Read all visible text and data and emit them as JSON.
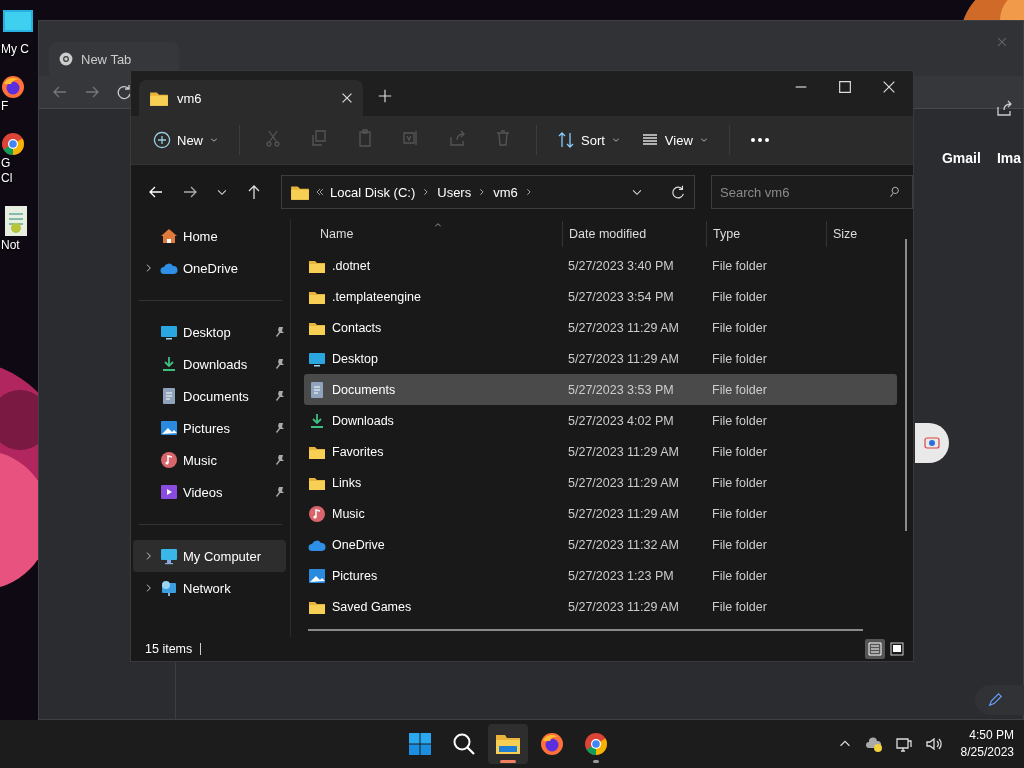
{
  "desktop_icons": [
    {
      "kind": "computer",
      "lines": [
        "My C"
      ]
    },
    {
      "kind": "firefox",
      "lines": [
        "F"
      ]
    },
    {
      "kind": "chrome",
      "lines": [
        "G",
        "Cl"
      ]
    },
    {
      "kind": "notepad",
      "lines": [
        "Not"
      ]
    }
  ],
  "browser": {
    "tab": "New Tab",
    "links": [
      "Gmail",
      "Ima"
    ]
  },
  "explorer": {
    "tab": {
      "title": "vm6"
    },
    "toolbar": {
      "new": "New",
      "sort": "Sort",
      "view": "View"
    },
    "address": {
      "crumbs": [
        "Local Disk (C:)",
        "Users",
        "vm6"
      ],
      "search_placeholder": "Search vm6"
    },
    "nav_sections": [
      {
        "items": [
          {
            "label": "Home",
            "kind": "home",
            "expandable": false,
            "pinned": false,
            "selected": false
          },
          {
            "label": "OneDrive",
            "kind": "onedrive",
            "expandable": true,
            "pinned": false,
            "selected": false
          }
        ]
      },
      {
        "items": [
          {
            "label": "Desktop",
            "kind": "desktop",
            "expandable": false,
            "pinned": true,
            "selected": false
          },
          {
            "label": "Downloads",
            "kind": "downloads",
            "expandable": false,
            "pinned": true,
            "selected": false
          },
          {
            "label": "Documents",
            "kind": "documents",
            "expandable": false,
            "pinned": true,
            "selected": false
          },
          {
            "label": "Pictures",
            "kind": "pictures",
            "expandable": false,
            "pinned": true,
            "selected": false
          },
          {
            "label": "Music",
            "kind": "music",
            "expandable": false,
            "pinned": true,
            "selected": false
          },
          {
            "label": "Videos",
            "kind": "videos",
            "expandable": false,
            "pinned": true,
            "selected": false
          }
        ]
      },
      {
        "items": [
          {
            "label": "My Computer",
            "kind": "computer",
            "expandable": true,
            "pinned": false,
            "selected": true
          },
          {
            "label": "Network",
            "kind": "network",
            "expandable": true,
            "pinned": false,
            "selected": false
          }
        ]
      }
    ],
    "columns": [
      "Name",
      "Date modified",
      "Type",
      "Size"
    ],
    "rows": [
      {
        "name": ".dotnet",
        "date": "5/27/2023 3:40 PM",
        "type": "File folder",
        "kind": "folder",
        "selected": false
      },
      {
        "name": ".templateengine",
        "date": "5/27/2023 3:54 PM",
        "type": "File folder",
        "kind": "folder",
        "selected": false
      },
      {
        "name": "Contacts",
        "date": "5/27/2023 11:29 AM",
        "type": "File folder",
        "kind": "folder",
        "selected": false
      },
      {
        "name": "Desktop",
        "date": "5/27/2023 11:29 AM",
        "type": "File folder",
        "kind": "desktop",
        "selected": false
      },
      {
        "name": "Documents",
        "date": "5/27/2023 3:53 PM",
        "type": "File folder",
        "kind": "documents",
        "selected": true
      },
      {
        "name": "Downloads",
        "date": "5/27/2023 4:02 PM",
        "type": "File folder",
        "kind": "downloads",
        "selected": false
      },
      {
        "name": "Favorites",
        "date": "5/27/2023 11:29 AM",
        "type": "File folder",
        "kind": "folder",
        "selected": false
      },
      {
        "name": "Links",
        "date": "5/27/2023 11:29 AM",
        "type": "File folder",
        "kind": "folder",
        "selected": false
      },
      {
        "name": "Music",
        "date": "5/27/2023 11:29 AM",
        "type": "File folder",
        "kind": "music",
        "selected": false
      },
      {
        "name": "OneDrive",
        "date": "5/27/2023 11:32 AM",
        "type": "File folder",
        "kind": "onedrive",
        "selected": false
      },
      {
        "name": "Pictures",
        "date": "5/27/2023 1:23 PM",
        "type": "File folder",
        "kind": "pictures",
        "selected": false
      },
      {
        "name": "Saved Games",
        "date": "5/27/2023 11:29 AM",
        "type": "File folder",
        "kind": "folder",
        "selected": false
      }
    ],
    "status": "15 items",
    "view_modes": [
      {
        "kind": "details",
        "selected": true
      },
      {
        "kind": "tiles",
        "selected": false
      }
    ]
  },
  "taskbar": {
    "apps": [
      {
        "kind": "start",
        "running": false,
        "active": false
      },
      {
        "kind": "search",
        "running": false,
        "active": false
      },
      {
        "kind": "explorer",
        "running": true,
        "active": true
      },
      {
        "kind": "firefox",
        "running": false,
        "active": false
      },
      {
        "kind": "chrome",
        "running": true,
        "active": false
      }
    ],
    "time": "4:50 PM",
    "date": "8/25/2023"
  }
}
